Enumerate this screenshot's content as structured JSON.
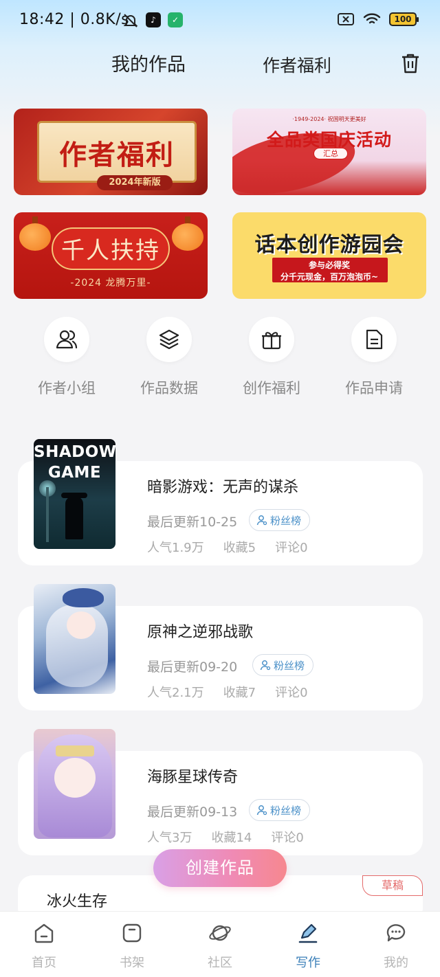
{
  "status_bar": {
    "time": "18:42 | 0.8K/s",
    "battery": "100"
  },
  "header": {
    "tab_works": "我的作品",
    "tab_welfare": "作者福利"
  },
  "banners": [
    {
      "title": "作者福利",
      "subtitle": "2024年新版"
    },
    {
      "title": "全品类国庆活动",
      "top_text": "·1949-2024· 祝国明天更美好",
      "tag": "汇总"
    },
    {
      "title": "千人扶持",
      "subtitle": "-2024 龙腾万里-"
    },
    {
      "title": "话本创作游园会",
      "line1": "参与必得奖",
      "line2": "分千元现金，百万泡泡币~"
    }
  ],
  "quick_actions": [
    {
      "label": "作者小组",
      "icon": "group-icon"
    },
    {
      "label": "作品数据",
      "icon": "layers-icon"
    },
    {
      "label": "创作福利",
      "icon": "gift-icon"
    },
    {
      "label": "作品申请",
      "icon": "document-icon"
    }
  ],
  "works": [
    {
      "title": "暗影游戏：无声的谋杀",
      "cover_text": "SHADOW GAME",
      "updated": "最后更新10-25",
      "fans_label": "粉丝榜",
      "popularity": "人气1.9万",
      "favorites": "收藏5",
      "comments": "评论0"
    },
    {
      "title": "原神之逆邪战歌",
      "updated": "最后更新09-20",
      "fans_label": "粉丝榜",
      "popularity": "人气2.1万",
      "favorites": "收藏7",
      "comments": "评论0"
    },
    {
      "title": "海豚星球传奇",
      "updated": "最后更新09-13",
      "fans_label": "粉丝榜",
      "popularity": "人气3万",
      "favorites": "收藏14",
      "comments": "评论0"
    }
  ],
  "draft": {
    "title": "冰火生存",
    "badge": "草稿"
  },
  "create_button": "创建作品",
  "bottom_nav": [
    {
      "label": "首页",
      "icon": "home-icon",
      "active": false
    },
    {
      "label": "书架",
      "icon": "bookshelf-icon",
      "active": false
    },
    {
      "label": "社区",
      "icon": "planet-icon",
      "active": false
    },
    {
      "label": "写作",
      "icon": "pen-icon",
      "active": true
    },
    {
      "label": "我的",
      "icon": "chat-bubble-icon",
      "active": false
    }
  ],
  "colors": {
    "accent": "#3b7fb8",
    "create_gradient_start": "#d9a0e6",
    "create_gradient_end": "#f6888f",
    "draft_badge": "#e46a6a"
  }
}
